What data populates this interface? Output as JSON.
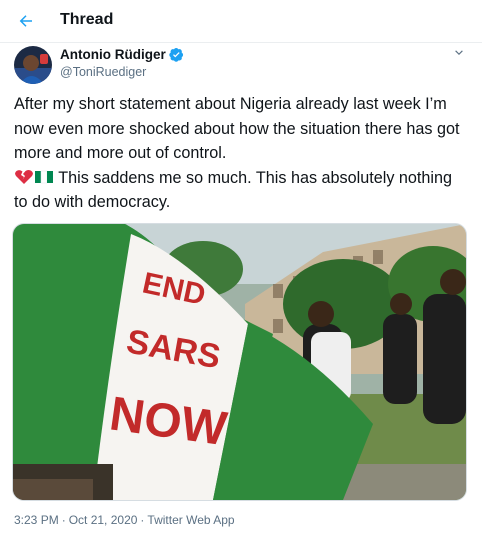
{
  "header": {
    "title": "Thread",
    "back_icon": "arrow-left-icon"
  },
  "tweet": {
    "author_name": "Antonio Rüdiger",
    "handle": "@ToniRuediger",
    "verified_icon": "verified-badge-icon",
    "menu_icon": "chevron-down-icon",
    "text_part1": "After my short statement about Nigeria already last week I’m now even more shocked about how the situation there has got more and more out of control.",
    "text_part2": "This saddens me so much. This has absolutely nothing to do with democracy.",
    "emojis": [
      "broken-heart-emoji",
      "nigeria-flag-emoji"
    ],
    "sign_text": "END SARS NOW",
    "time": "3:23 PM",
    "date": "Oct 21, 2020",
    "source": "Twitter Web App",
    "separator": "·"
  },
  "colors": {
    "accent": "#1da1f2",
    "secondary_text": "#5b7083",
    "flag_green": "#2f8a3c"
  }
}
